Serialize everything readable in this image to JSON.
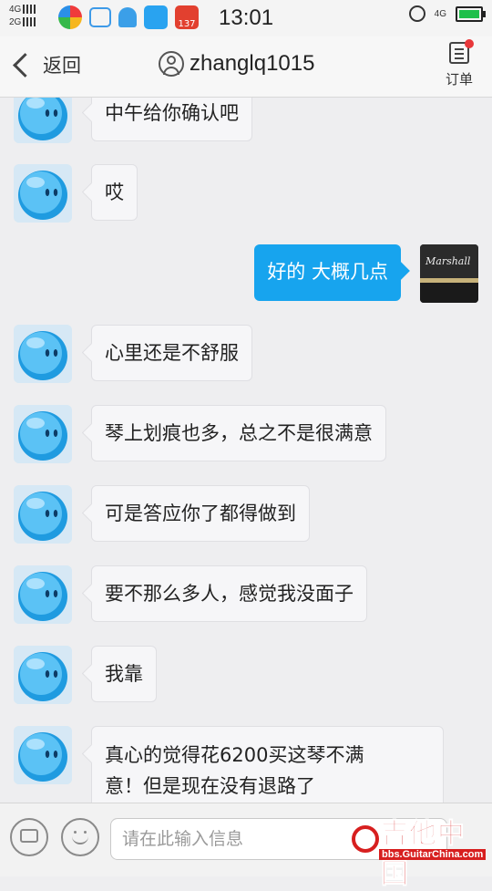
{
  "status_bar": {
    "network_top": "4G",
    "network_bottom": "2G",
    "time": "13:01",
    "data_type": "4G",
    "notification_badge": "137",
    "battery_level": 0.85,
    "battery_color": "#1fbf4a"
  },
  "header": {
    "back_label": "返回",
    "title": "zhanglq1015",
    "order_label": "订单"
  },
  "messages": [
    {
      "side": "left",
      "text": "中午给你确认吧"
    },
    {
      "side": "left",
      "text": "哎"
    },
    {
      "side": "right",
      "text": "好的  大概几点"
    },
    {
      "side": "left",
      "text": "心里还是不舒服"
    },
    {
      "side": "left",
      "text": "琴上划痕也多，总之不是很满意"
    },
    {
      "side": "left",
      "text": "可是答应你了都得做到"
    },
    {
      "side": "left",
      "text": "要不那么多人，感觉我没面子"
    },
    {
      "side": "left",
      "text": "我靠"
    },
    {
      "side": "left",
      "text_line1": "真心的觉得花6200买这琴不满",
      "text_line2": "意！但是现在没有退路了"
    }
  ],
  "my_avatar_text": "Marshall",
  "input_bar": {
    "placeholder": "请在此输入信息"
  },
  "watermark": {
    "main": "吉他中国",
    "sub": "bbs.GuitarChina.com"
  },
  "colors": {
    "accent": "#17a4ee",
    "watermark": "#d71f1f"
  }
}
